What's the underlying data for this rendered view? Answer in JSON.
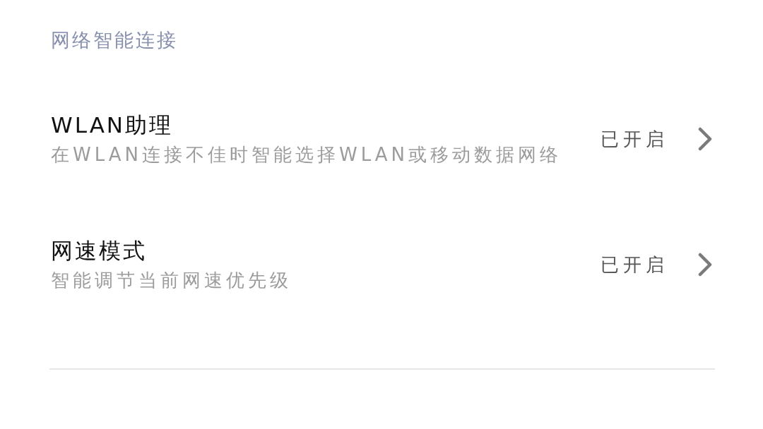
{
  "section": {
    "title": "网络智能连接"
  },
  "items": [
    {
      "title": "WLAN助理",
      "description": "在WLAN连接不佳时智能选择WLAN或移动数据网络",
      "status": "已开启"
    },
    {
      "title": "网速模式",
      "description": "智能调节当前网速优先级",
      "status": "已开启"
    }
  ]
}
